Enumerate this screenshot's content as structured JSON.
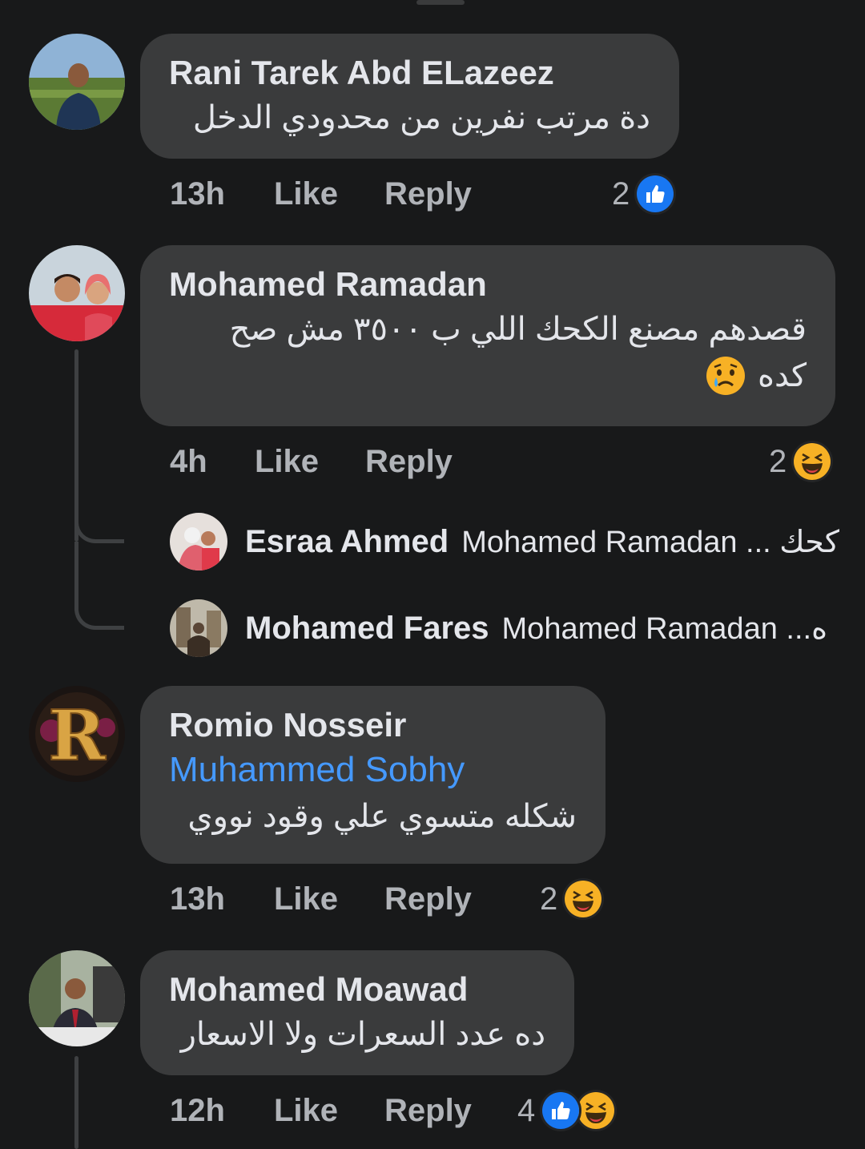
{
  "colors": {
    "background": "#18191a",
    "bubble": "#3a3b3c",
    "text": "#e4e6eb",
    "muted": "#b0b3b8",
    "mention": "#4599ff",
    "like_blue": "#1877f2",
    "haha_yellow": "#f7b125"
  },
  "comments": [
    {
      "author": "Rani Tarek Abd ELazeez",
      "text": "دة مرتب نفرين من محدودي الدخل",
      "time": "13h",
      "like_label": "Like",
      "reply_label": "Reply",
      "reaction_count": "2",
      "reactions": [
        "like-icon"
      ]
    },
    {
      "author": "Mohamed Ramadan",
      "text_line1": "قصدهم مصنع الكحك اللي ب ٣٥٠٠ مش صح",
      "text_line2": "كده",
      "emoji": "crying-face-icon",
      "time": "4h",
      "like_label": "Like",
      "reply_label": "Reply",
      "reaction_count": "2",
      "reactions": [
        "haha-icon"
      ],
      "replies": [
        {
          "author": "Esraa Ahmed",
          "snippet": "Mohamed Ramadan ... كحك"
        },
        {
          "author": "Mohamed Fares",
          "snippet": "Mohamed Ramadan ...ه"
        }
      ]
    },
    {
      "author": "Romio Nosseir",
      "mention": "Muhammed Sobhy",
      "text": "شكله متسوي علي وقود نووي",
      "time": "13h",
      "like_label": "Like",
      "reply_label": "Reply",
      "reaction_count": "2",
      "reactions": [
        "haha-icon"
      ]
    },
    {
      "author": "Mohamed Moawad",
      "text": "ده عدد السعرات ولا الاسعار",
      "time": "12h",
      "like_label": "Like",
      "reply_label": "Reply",
      "reaction_count": "4",
      "reactions": [
        "like-icon",
        "haha-icon"
      ]
    }
  ]
}
